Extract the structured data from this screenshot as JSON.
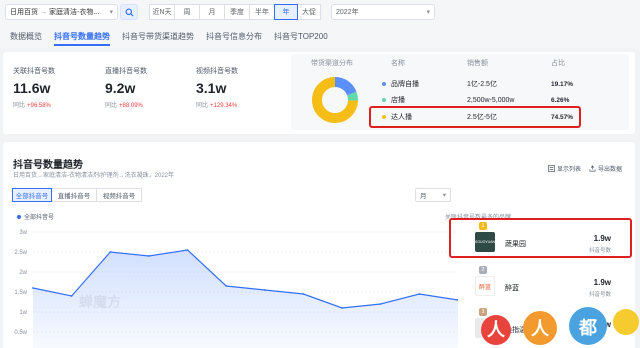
{
  "filters": {
    "category_path": [
      "日用百货",
      "家庭清洁-衣物..."
    ],
    "periods": [
      "近N天",
      "周",
      "月",
      "季度",
      "半年",
      "年",
      "大促"
    ],
    "active_period": "年",
    "year": "2022年"
  },
  "tabs": [
    "数据概览",
    "抖音号数量趋势",
    "抖音号带货渠道趋势",
    "抖音号信息分布",
    "抖音号TOP200"
  ],
  "active_tab": "抖音号数量趋势",
  "metrics": [
    {
      "label": "关联抖音号数",
      "value": "11.6w",
      "change_label": "同比",
      "change": "+96.58%"
    },
    {
      "label": "直播抖音号数",
      "value": "9.2w",
      "change_label": "同比",
      "change": "+88.09%"
    },
    {
      "label": "视频抖音号数",
      "value": "3.1w",
      "change_label": "同比",
      "change": "+129.34%"
    }
  ],
  "distribution": {
    "title": "带货渠道分布",
    "headers": {
      "name": "名称",
      "sales": "销售额",
      "share": "占比"
    },
    "rows": [
      {
        "name": "品牌自播",
        "sales": "1亿-2.5亿",
        "share": "19.17%",
        "color": "#5b8ff9"
      },
      {
        "name": "店播",
        "sales": "2,500w-5,000w",
        "share": "6.26%",
        "color": "#61d9aa"
      },
      {
        "name": "达人播",
        "sales": "2.5亿-5亿",
        "share": "74.57%",
        "color": "#f6bd16"
      }
    ],
    "donut_values": [
      19.17,
      6.26,
      74.57
    ]
  },
  "trend": {
    "title": "抖音号数量趋势",
    "subtitle": "日用百货→家庭清洁-衣物清洁剂/护理剂→洗衣凝珠，2022年",
    "tools": {
      "list": "显示列表",
      "export": "导出数据"
    },
    "type_tabs": [
      "全部抖音号",
      "直播抖音号",
      "视频抖音号"
    ],
    "active_type": "全部抖音号",
    "granularity": "月",
    "legend": "全部抖音号",
    "ranking_title": "关联抖音号数最多的品牌",
    "ranking": [
      {
        "rank": "1",
        "brand": "蔬果园",
        "logo_text": "SGUOYUAN",
        "value": "1.9w",
        "value_label": "抖音号数",
        "badge_color": "#f7ba1e",
        "logo_color": "#2f4a44"
      },
      {
        "rank": "2",
        "brand": "醉蓝",
        "logo_text": "醉蓝",
        "value": "1.9w",
        "value_label": "抖音号数",
        "badge_color": "#a9aeb8",
        "logo_color": "#ffffff"
      },
      {
        "rank": "3",
        "brand": "染指温猫",
        "logo_text": "",
        "value": "1.1w",
        "value_label": "",
        "badge_color": "#c9a27e",
        "logo_color": "#eaeaea"
      }
    ]
  },
  "chart_data": {
    "type": "area",
    "series": [
      {
        "name": "全部抖音号",
        "values": [
          1.6,
          1.4,
          2.5,
          2.4,
          2.55,
          1.65,
          1.55,
          1.45,
          1.1,
          1.2,
          1.45,
          1.3
        ]
      }
    ],
    "y_ticks": [
      "3w",
      "2.5w",
      "2w",
      "1.5w",
      "1w",
      "0.5w"
    ],
    "ylim": [
      0,
      3.2
    ],
    "grid": true,
    "color": "#3370ff"
  },
  "watermark": "蝉魔方",
  "brand_logo": "人人都是产品经理"
}
